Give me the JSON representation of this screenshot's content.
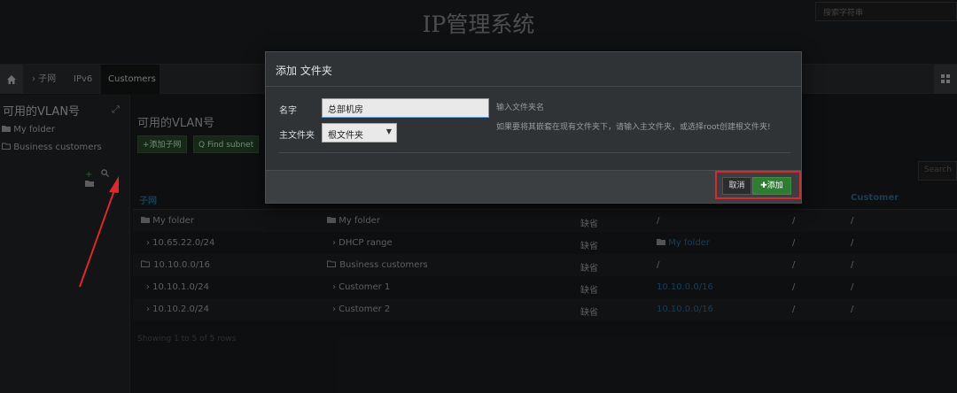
{
  "header": {
    "title": "IP管理系统",
    "subtitle": "",
    "search_placeholder": "搜索字符串"
  },
  "nav": {
    "home_icon": "home-icon",
    "items": [
      {
        "label": "› 子网"
      },
      {
        "label": "IPv6"
      },
      {
        "label": "Customers"
      }
    ],
    "right_icon": "grid-icon"
  },
  "sidebar": {
    "title": "可用的VLAN号",
    "items": [
      {
        "label": "My folder",
        "icon": "folder-filled-icon"
      },
      {
        "label": "Business customers",
        "icon": "folder-open-icon"
      }
    ],
    "tools": {
      "add": "+",
      "search": "search-icon",
      "folder": "folder-icon"
    }
  },
  "main": {
    "title": "可用的VLAN号",
    "buttons": {
      "add_subnet": "+添加子网",
      "find_subnet": "Q Find subnet"
    },
    "search_placeholder": "Search",
    "columns": [
      "子网",
      "",
      "",
      "",
      "",
      "Customer"
    ],
    "rows": [
      {
        "subnet": "My folder",
        "desc": "My folder",
        "vlan": "缺省",
        "master": "/",
        "device": "/",
        "customer": "/"
      },
      {
        "subnet": "› 10.65.22.0/24",
        "desc": "› DHCP range",
        "vlan": "缺省",
        "master": "My folder",
        "device": "/",
        "customer": "/"
      },
      {
        "subnet": "10.10.0.0/16",
        "desc": "Business customers",
        "vlan": "缺省",
        "master": "/",
        "device": "/",
        "customer": "/"
      },
      {
        "subnet": "› 10.10.1.0/24",
        "desc": "› Customer 1",
        "vlan": "缺省",
        "master": "10.10.0.0/16",
        "device": "/",
        "customer": "/"
      },
      {
        "subnet": "› 10.10.2.0/24",
        "desc": "› Customer 2",
        "vlan": "缺省",
        "master": "10.10.0.0/16",
        "device": "/",
        "customer": "/"
      }
    ],
    "footer": "Showing 1 to 5 of 5 rows"
  },
  "modal": {
    "title": "添加 文件夹",
    "name_label": "名字",
    "name_value": "总部机房",
    "name_hint": "输入文件夹名",
    "parent_label": "主文件夹",
    "parent_value": "根文件夹",
    "parent_hint": "如果要将其嵌套在现有文件夹下，请输入主文件夹，或选择root创建根文件夹!",
    "cancel_label": "取消",
    "add_label": "✚添加"
  },
  "colors": {
    "accent_link": "#2a6f9a",
    "add_button": "#2e7d32",
    "highlight": "#e0262a"
  }
}
